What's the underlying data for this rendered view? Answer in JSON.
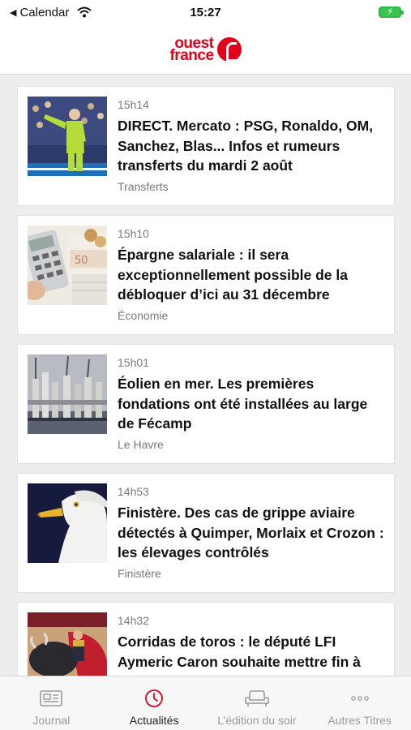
{
  "status_bar": {
    "back_label": "Calendar",
    "time": "15:27"
  },
  "header": {
    "logo_line1": "ouest",
    "logo_line2": "france"
  },
  "articles": [
    {
      "time": "15h14",
      "title": "DIRECT. Mercato : PSG, Ronaldo, OM, Sanchez, Blas... Infos et rumeurs transferts du mardi 2 août",
      "category": "Transferts"
    },
    {
      "time": "15h10",
      "title": "Épargne salariale : il sera exceptionnellement possible de la débloquer d’ici au 31 décembre",
      "category": "Économie"
    },
    {
      "time": "15h01",
      "title": "Éolien en mer. Les premières fondations ont été installées au large de Fécamp",
      "category": "Le Havre"
    },
    {
      "time": "14h53",
      "title": "Finistère. Des cas de grippe aviaire détectés à Quimper, Morlaix et Crozon : les élevages contrôlés",
      "category": "Finistère"
    },
    {
      "time": "14h32",
      "title": "Corridas de toros : le député LFI Aymeric Caron souhaite mettre fin à",
      "category": ""
    }
  ],
  "tabs": [
    {
      "label": "Journal",
      "icon": "newspaper-icon"
    },
    {
      "label": "Actualités",
      "icon": "clock-icon",
      "active": true
    },
    {
      "label": "L’édition du soir",
      "icon": "sofa-icon"
    },
    {
      "label": "Autres Titres",
      "icon": "more-dots-icon"
    }
  ],
  "colors": {
    "brand": "#e2001a",
    "active_tab_icon": "#e2001a",
    "battery": "#39c451"
  }
}
